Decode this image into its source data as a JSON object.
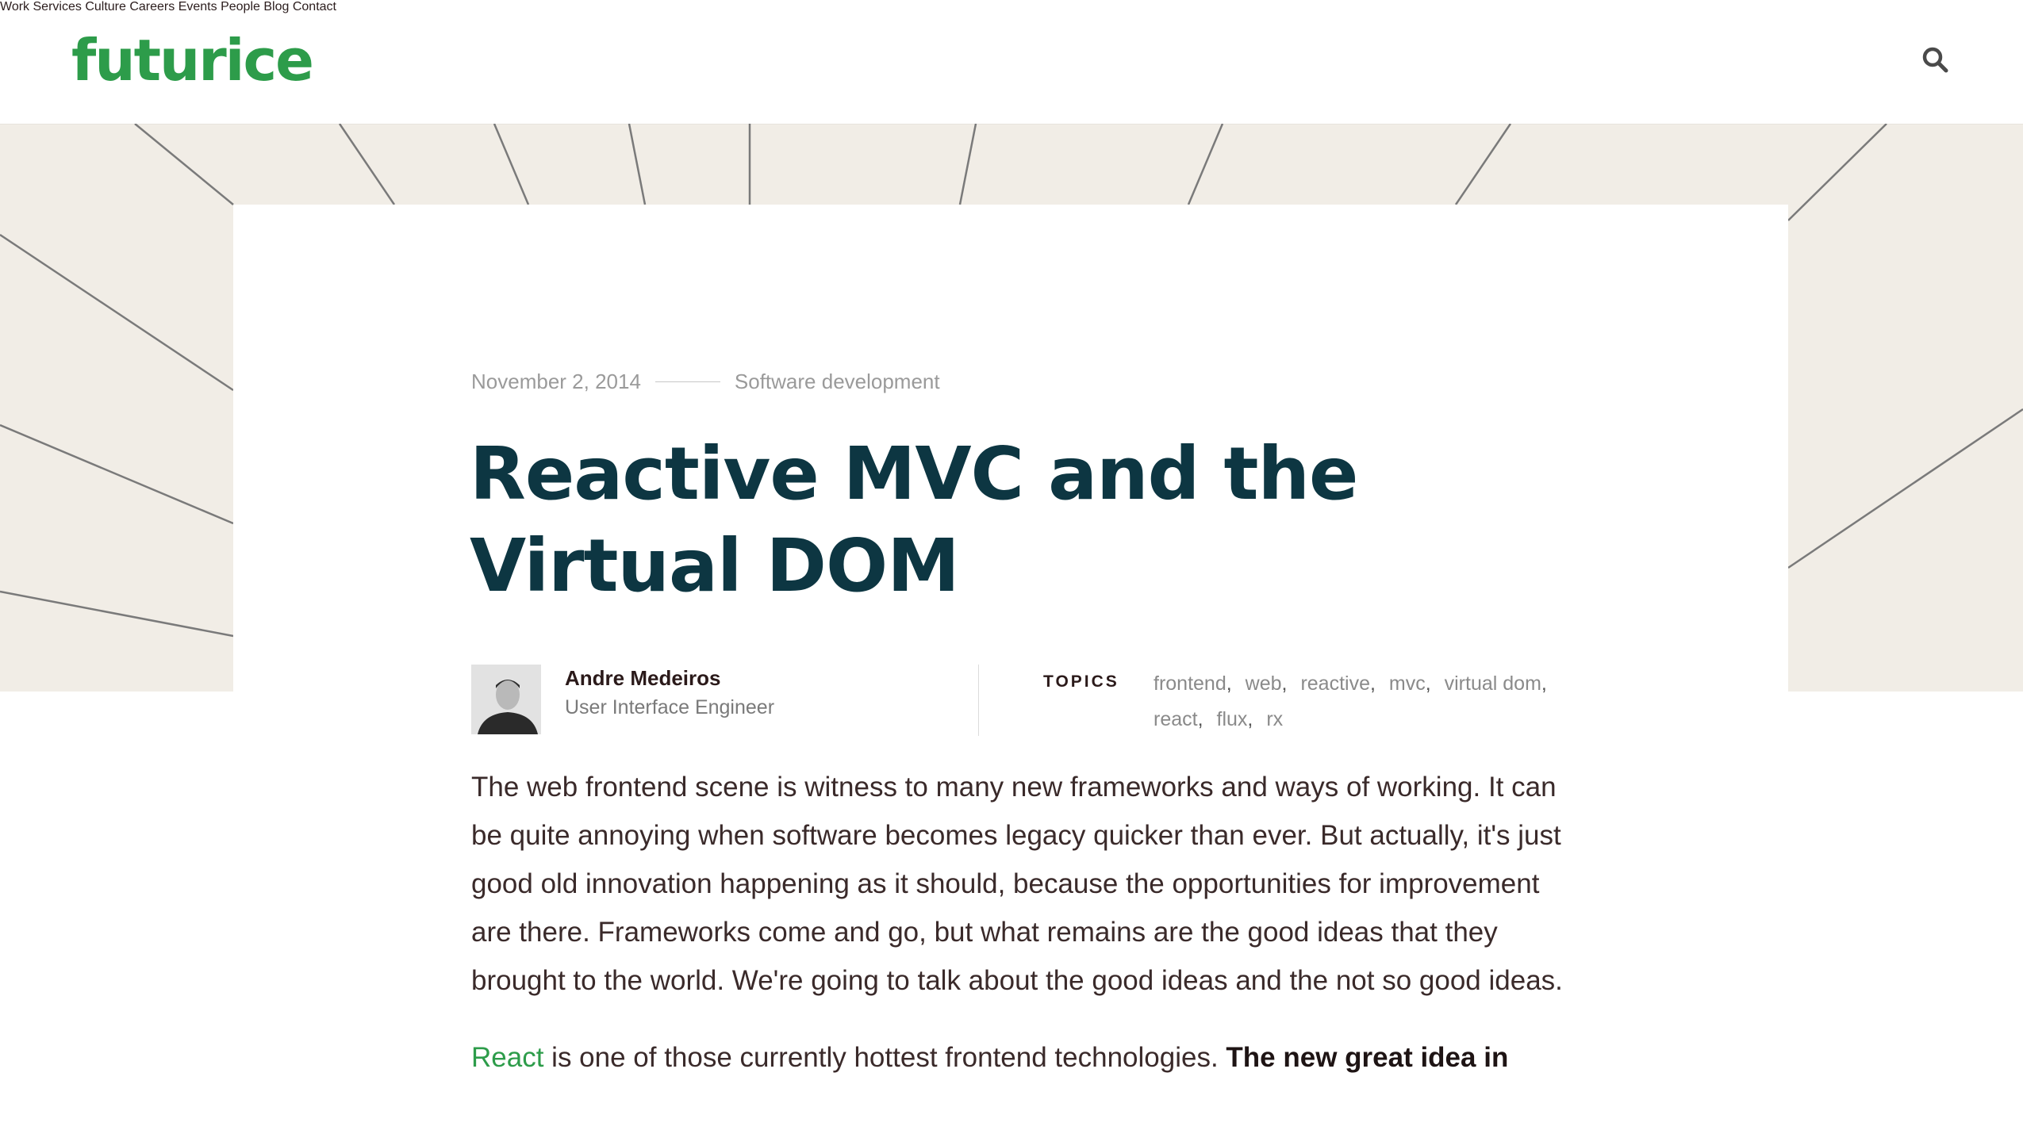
{
  "header": {
    "logo": "futurice",
    "nav": [
      "Work",
      "Services",
      "Culture",
      "Careers",
      "Events",
      "People",
      "Blog",
      "Contact"
    ]
  },
  "article": {
    "date": "November 2, 2014",
    "category": "Software development",
    "title": "Reactive MVC and the Virtual DOM",
    "author": {
      "name": "Andre Medeiros",
      "role": "User Interface Engineer"
    },
    "topics_label": "TOPICS",
    "topics": [
      "frontend",
      "web",
      "reactive",
      "mvc",
      "virtual dom",
      "react",
      "flux",
      "rx"
    ],
    "paragraph1": "The web frontend scene is witness to many new frameworks and ways of working. It can be quite annoying when software becomes legacy quicker than ever. But actually, it's just good old innovation happening as it should, because the opportunities for improvement are there. Frameworks come and go, but what remains are the good ideas that they brought to the world. We're going to talk about the good ideas and the not so good ideas.",
    "paragraph2_link": "React",
    "paragraph2_text": " is one of those currently hottest frontend technologies. ",
    "paragraph2_bold": "The new great idea in"
  },
  "colors": {
    "brand": "#2d9c4a",
    "title": "#0d3642",
    "hero_bg": "#f1ede6"
  },
  "icons": {
    "search": "search-icon"
  }
}
